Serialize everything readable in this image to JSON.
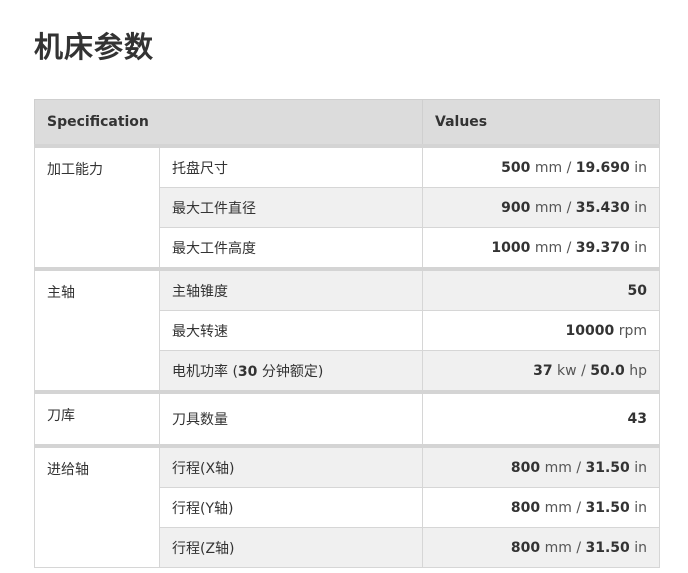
{
  "page_title": "机床参数",
  "table": {
    "header": {
      "spec": "Specification",
      "values": "Values"
    },
    "groups": [
      {
        "name": "加工能力",
        "rows": [
          {
            "label": "托盘尺寸",
            "v1": "500",
            "u1": "mm",
            "sep": "/",
            "v2": "19.690",
            "u2": "in"
          },
          {
            "label": "最大工件直径",
            "v1": "900",
            "u1": "mm",
            "sep": "/",
            "v2": "35.430",
            "u2": "in"
          },
          {
            "label": "最大工件高度",
            "v1": "1000",
            "u1": "mm",
            "sep": "/",
            "v2": "39.370",
            "u2": "in"
          }
        ]
      },
      {
        "name": "主轴",
        "rows": [
          {
            "label": "主轴锥度",
            "v1": "50"
          },
          {
            "label": "最大转速",
            "v1": "10000",
            "u1": "rpm"
          },
          {
            "label_pre": "电机功率 (",
            "label_num": "30",
            "label_post": " 分钟额定)",
            "v1": "37",
            "u1": "kw",
            "sep": "/",
            "v2": "50.0",
            "u2": "hp"
          }
        ]
      },
      {
        "name": "刀库",
        "rows": [
          {
            "label": "刀具数量",
            "v1": "43"
          }
        ]
      },
      {
        "name": "进给轴",
        "rows": [
          {
            "label": "行程(X轴)",
            "v1": "800",
            "u1": "mm",
            "sep": "/",
            "v2": "31.50",
            "u2": "in"
          },
          {
            "label": "行程(Y轴)",
            "v1": "800",
            "u1": "mm",
            "sep": "/",
            "v2": "31.50",
            "u2": "in"
          },
          {
            "label": "行程(Z轴)",
            "v1": "800",
            "u1": "mm",
            "sep": "/",
            "v2": "31.50",
            "u2": "in"
          }
        ]
      }
    ]
  }
}
